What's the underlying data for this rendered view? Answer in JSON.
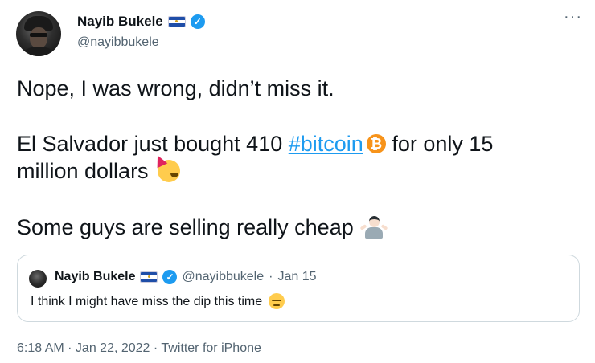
{
  "author": {
    "display_name": "Nayib Bukele",
    "handle": "@nayibbukele"
  },
  "tweet": {
    "line1": "Nope, I was wrong, didn’t miss it.",
    "line2_before": "El Salvador just bought 410 ",
    "hashtag": "#bitcoin",
    "line2_after": "  for only 15",
    "line3": "million dollars",
    "line4": "Some guys are selling really cheap",
    "emoji_icons": [
      "bitcoin-icon",
      "partying-face-icon",
      "person-shrugging-icon"
    ]
  },
  "quoted_tweet": {
    "display_name": "Nayib Bukele",
    "handle": "@nayibbukele",
    "separator": "·",
    "date": "Jan 15",
    "text": "I think I might have miss the dip this time",
    "emoji_icon": "pensive-face-icon"
  },
  "footer": {
    "time": "6:18 AM · Jan 22, 2022",
    "separator": " · ",
    "source": "Twitter for iPhone"
  },
  "icons": {
    "bitcoin_symbol": "₿",
    "more": "···",
    "verified_check": "✓"
  },
  "colors": {
    "link_blue": "#1d9bf0",
    "secondary_text": "#536471",
    "bitcoin_orange": "#f7931a",
    "border": "#cfd9de"
  }
}
